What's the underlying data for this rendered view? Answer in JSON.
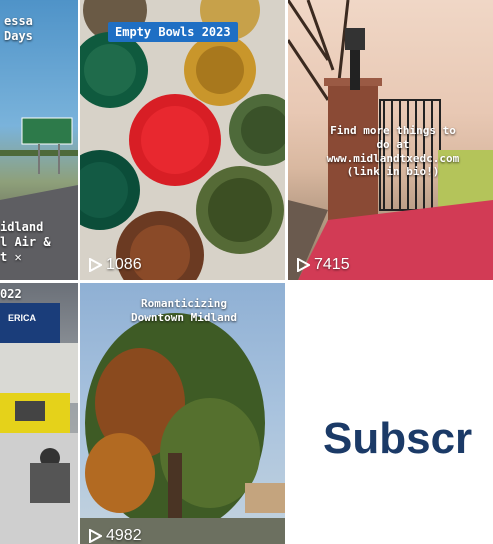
{
  "tiles": [
    {
      "id": "odessa",
      "overlay": "essa\nDays",
      "bottom_overlay": "idland\nl Air &\nt ✕"
    },
    {
      "id": "bowls",
      "badge": "Empty Bowls 2023",
      "views": "1086"
    },
    {
      "id": "lamp",
      "overlay": "Find more things to\ndo at\nwww.midlandtxedc.com\n(link in bio!)",
      "views": "7415"
    },
    {
      "id": "expo",
      "overlay": "022",
      "sign": "ERICA"
    },
    {
      "id": "tree",
      "overlay": "Romanticizing\nDowntown Midland",
      "views": "4982"
    }
  ],
  "subscribe_label": "Subscr"
}
